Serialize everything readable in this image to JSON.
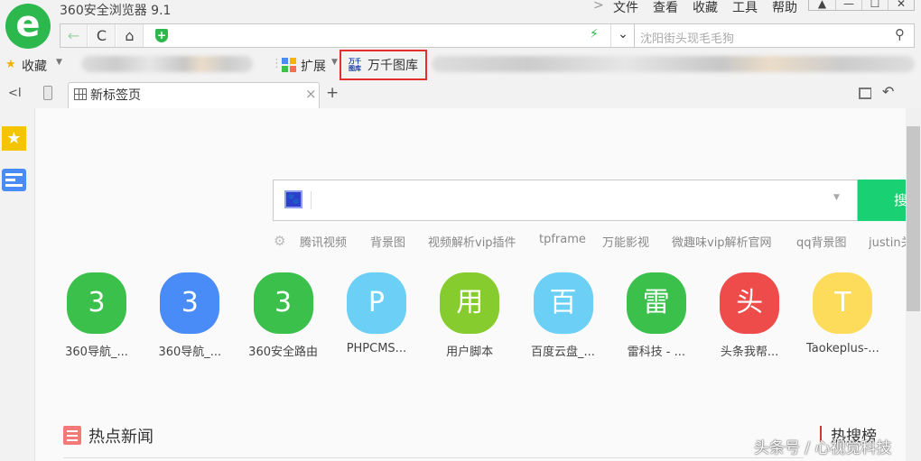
{
  "window": {
    "title": "360安全浏览器 9.1",
    "menu": [
      "文件",
      "查看",
      "收藏",
      "工具",
      "帮助"
    ],
    "more": ">",
    "controls": [
      "▲",
      "—",
      "☐",
      "✕"
    ]
  },
  "address": {
    "back": "←",
    "reload": "C",
    "home": "⌂",
    "url": "",
    "boost": "⚡",
    "dropdown": "⌄"
  },
  "search_bar": {
    "placeholder": "沈阳街头现毛毛狗",
    "icon": "search-icon"
  },
  "bookmarks": {
    "favorites": "收藏",
    "extensions": "扩展",
    "highlighted": "万千图库",
    "highlight_icon_text": "万千图库"
  },
  "tabs": [
    {
      "label": "新标签页",
      "close": "×"
    }
  ],
  "tab_new": "+",
  "tab_left": "<I",
  "main": {
    "search": {
      "value": "",
      "button": "搜"
    },
    "suggestions": [
      "腾讯视频",
      "背景图",
      "视频解析vip插件",
      "tpframe",
      "万能影视",
      "微趣味vip解析官网",
      "qq背景图",
      "justin关"
    ],
    "tiles": [
      {
        "letter": "3",
        "label": "360导航_...",
        "color": "#3cc04c"
      },
      {
        "letter": "3",
        "label": "360导航_...",
        "color": "#4a8cf7"
      },
      {
        "letter": "3",
        "label": "360安全路由",
        "color": "#3cc04c"
      },
      {
        "letter": "P",
        "label": "PHPCMS...",
        "color": "#6ccff6"
      },
      {
        "letter": "用",
        "label": "用户脚本",
        "color": "#86cc2e"
      },
      {
        "letter": "百",
        "label": "百度云盘_...",
        "color": "#6ccff6"
      },
      {
        "letter": "雷",
        "label": "雷科技 - ...",
        "color": "#3cc04c"
      },
      {
        "letter": "头",
        "label": "头条我帮...",
        "color": "#ee4b4b"
      },
      {
        "letter": "T",
        "label": "Taokeplus-...",
        "color": "#fddc5c"
      }
    ],
    "news_title": "热点新闻",
    "hot_title": "热搜榜"
  },
  "watermark": "头条号 / 心视觉科技"
}
